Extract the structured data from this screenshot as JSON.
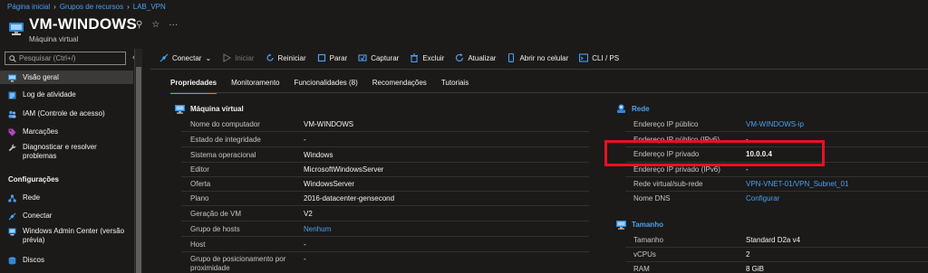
{
  "breadcrumb": [
    "Página inicial",
    "Grupos de recursos",
    "LAB_VPN"
  ],
  "header": {
    "title": "VM-WINDOWS",
    "subtitle": "Máquina virtual"
  },
  "search": {
    "placeholder": "Pesquisar (Ctrl+/)"
  },
  "sidebar": {
    "items": [
      {
        "label": "Visão geral",
        "icon": "monitor-icon",
        "active": true
      },
      {
        "label": "Log de atividade",
        "icon": "log-icon"
      },
      {
        "label": "IAM (Controle de acesso)",
        "icon": "people-icon"
      },
      {
        "label": "Marcações",
        "icon": "tag-icon"
      },
      {
        "label": "Diagnosticar e resolver problemas",
        "icon": "wrench-icon"
      }
    ],
    "section": "Configurações",
    "config_items": [
      {
        "label": "Rede",
        "icon": "network-icon"
      },
      {
        "label": "Conectar",
        "icon": "connect-icon"
      },
      {
        "label": "Windows Admin Center (versão prévia)",
        "icon": "windows-admin-icon"
      },
      {
        "label": "Discos",
        "icon": "disk-icon"
      }
    ]
  },
  "toolbar": {
    "connect": "Conectar",
    "start": "Iniciar",
    "restart": "Reiniciar",
    "stop": "Parar",
    "capture": "Capturar",
    "delete": "Excluir",
    "refresh": "Atualizar",
    "mobile": "Abrir no celular",
    "cli": "CLI / PS"
  },
  "tabs": [
    "Propriedades",
    "Monitoramento",
    "Funcionalidades (8)",
    "Recomendações",
    "Tutoriais"
  ],
  "vm_section": {
    "title": "Máquina virtual",
    "rows": [
      {
        "label": "Nome do computador",
        "value": "VM-WINDOWS"
      },
      {
        "label": "Estado de integridade",
        "value": "-"
      },
      {
        "label": "Sistema operacional",
        "value": "Windows"
      },
      {
        "label": "Editor",
        "value": "MicrosoftWindowsServer"
      },
      {
        "label": "Oferta",
        "value": "WindowsServer"
      },
      {
        "label": "Plano",
        "value": "2016-datacenter-gensecond"
      },
      {
        "label": "Geração de VM",
        "value": "V2"
      },
      {
        "label": "Grupo de hosts",
        "value": "Nenhum"
      },
      {
        "label": "Host",
        "value": "-"
      },
      {
        "label": "Grupo de posicionamento por proximidade",
        "value": "-"
      }
    ]
  },
  "net_section": {
    "title": "Rede",
    "rows": [
      {
        "label": "Endereço IP público",
        "value": "VM-WINDOWS-ip"
      },
      {
        "label": "Endereço IP público (IPv6)",
        "value": "-"
      },
      {
        "label": "Endereço IP privado",
        "value": "10.0.0.4"
      },
      {
        "label": "Endereço IP privado (IPv6)",
        "value": "-"
      },
      {
        "label": "Rede virtual/sub-rede",
        "value": "VPN-VNET-01/VPN_Subnet_01"
      },
      {
        "label": "Nome DNS",
        "value": "Configurar"
      }
    ]
  },
  "size_section": {
    "title": "Tamanho",
    "rows": [
      {
        "label": "Tamanho",
        "value": "Standard D2a v4"
      },
      {
        "label": "vCPUs",
        "value": "2"
      },
      {
        "label": "RAM",
        "value": "8 GiB"
      }
    ]
  },
  "colors": {
    "accent": "#4aa0f0",
    "highlight": "#e81123",
    "background": "#1b1a19"
  }
}
